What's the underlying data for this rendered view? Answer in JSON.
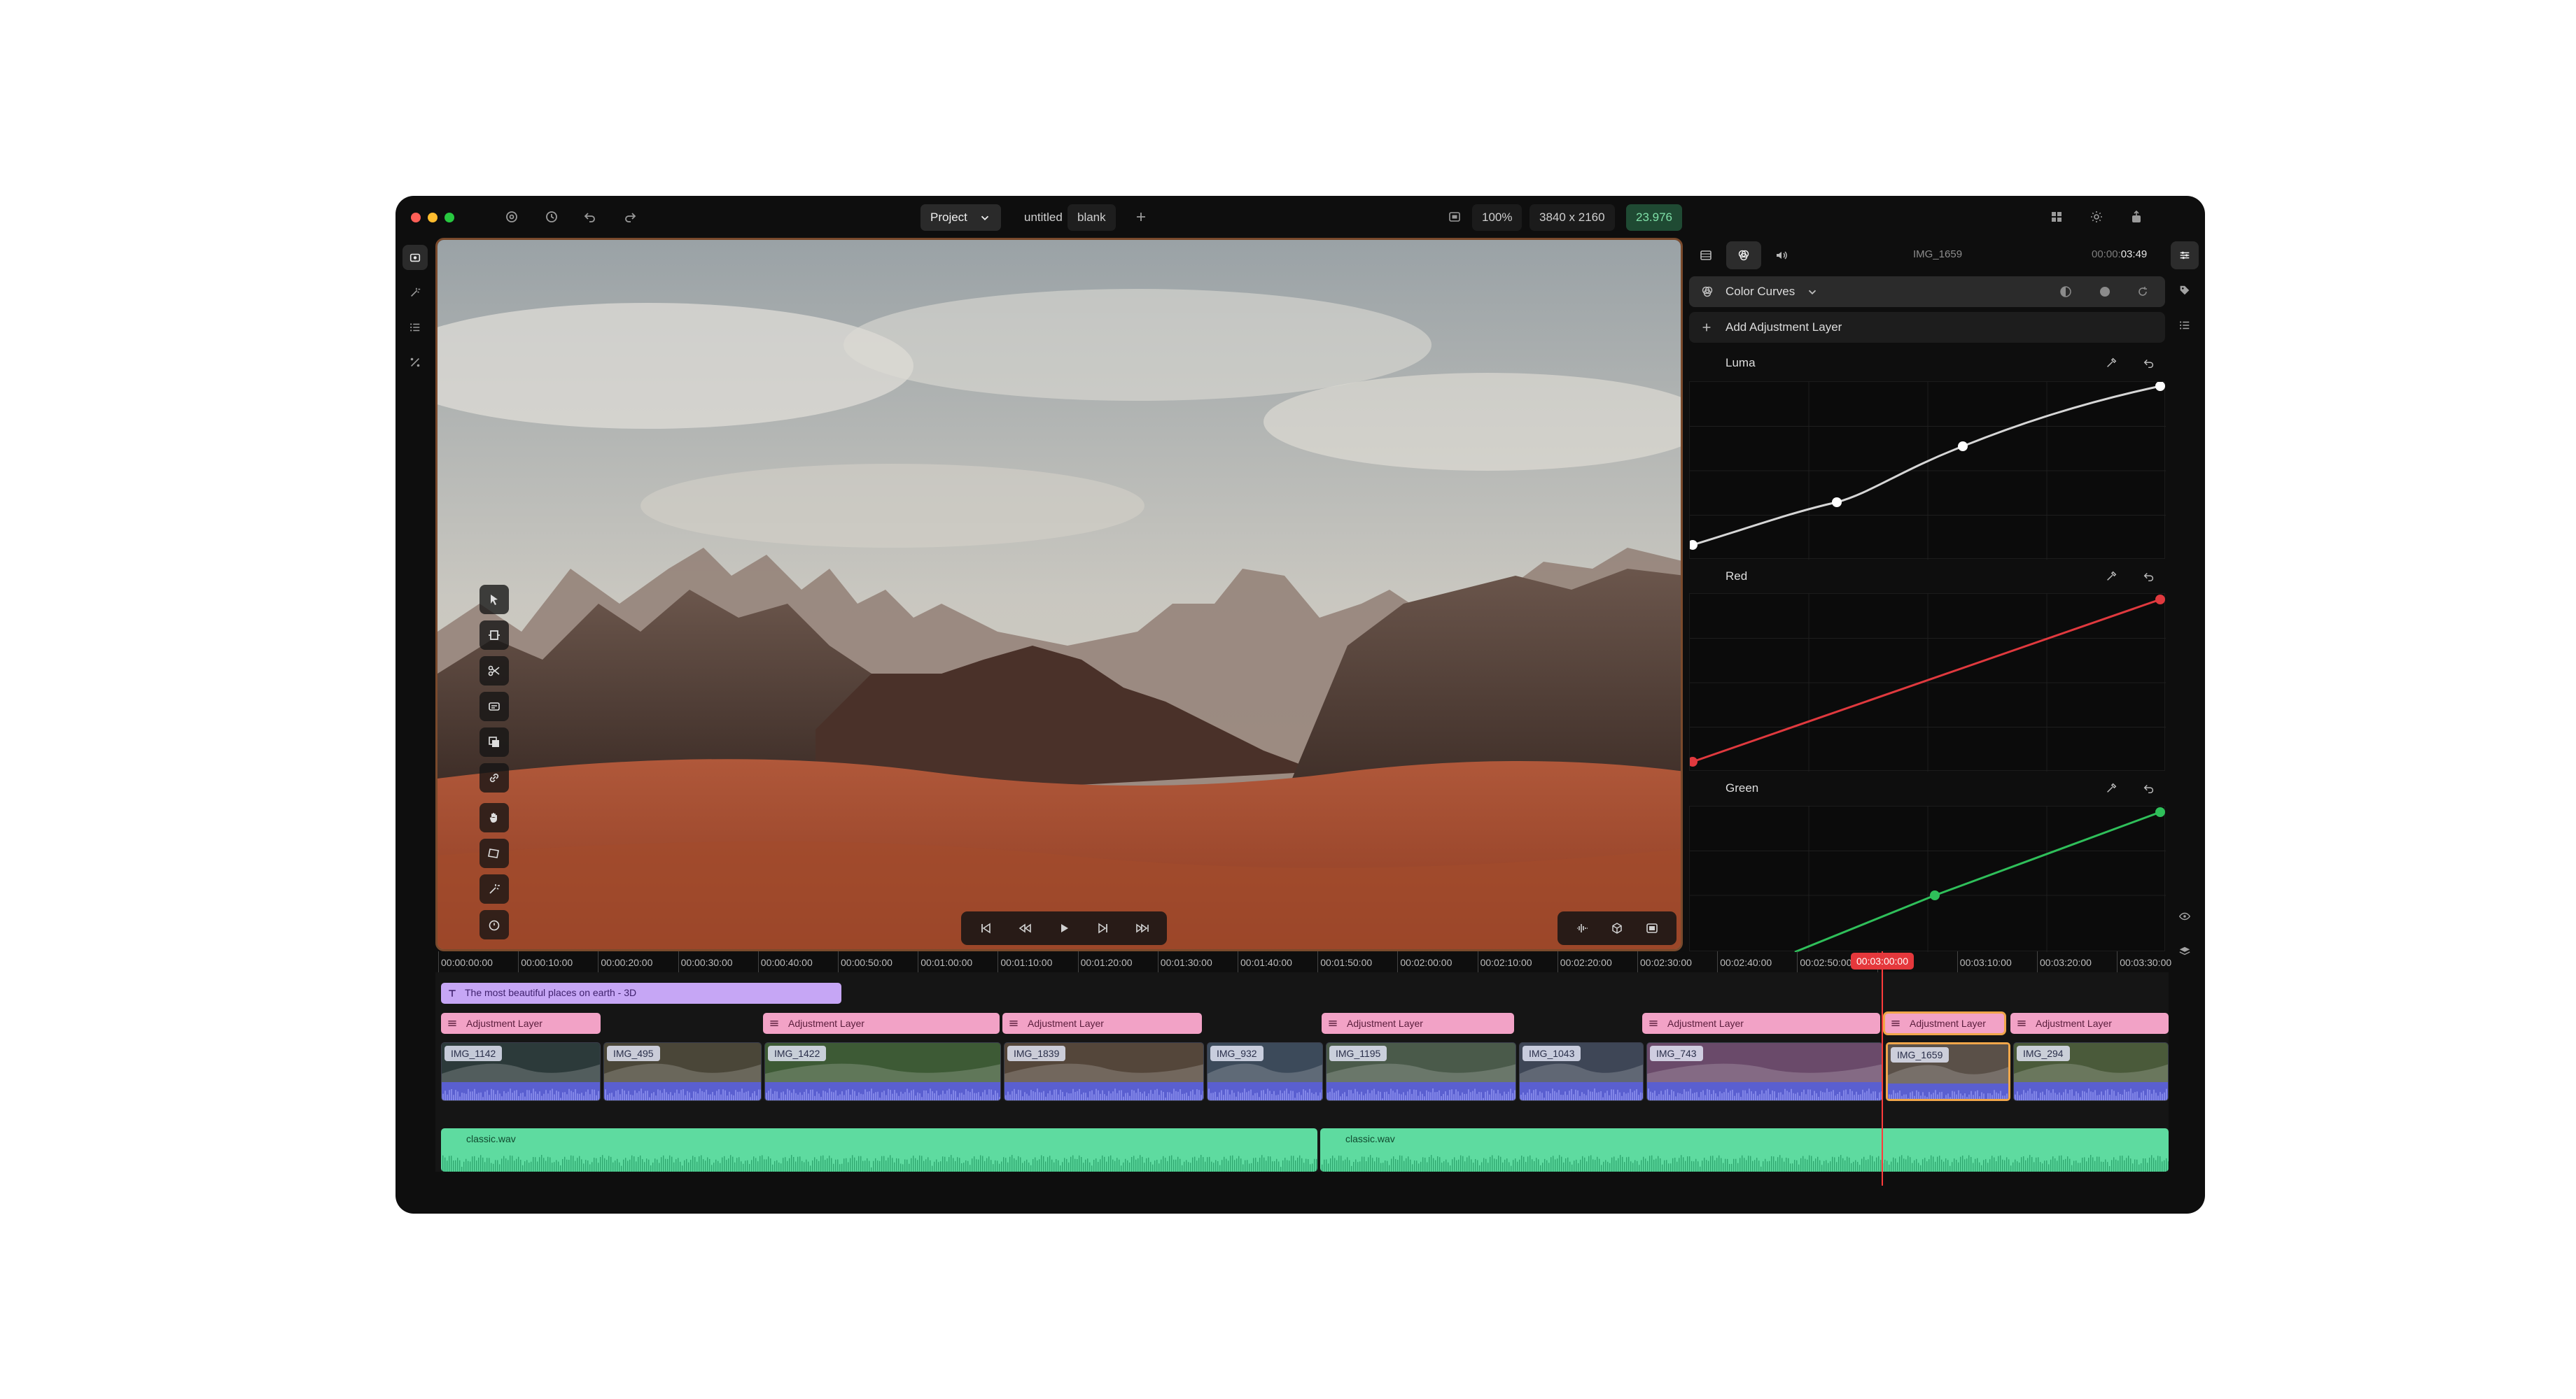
{
  "titlebar": {
    "project_label": "Project",
    "project_name": "untitled",
    "template_name": "blank",
    "zoom": "100%",
    "resolution": "3840 x 2160",
    "fps": "23.976"
  },
  "inspector": {
    "clip_name": "IMG_1659",
    "timecode_dim": "00:00:",
    "timecode_bright": "03:49",
    "effect_name": "Color Curves",
    "add_layer_label": "Add Adjustment Layer",
    "curves": [
      {
        "label": "Luma",
        "color": "#d6d6d6"
      },
      {
        "label": "Red",
        "color": "#e0393e"
      },
      {
        "label": "Green",
        "color": "#2fbf5a"
      }
    ]
  },
  "timeline": {
    "ruler_labels": [
      "00:00:00:00",
      "00:00:10:00",
      "00:00:20:00",
      "00:00:30:00",
      "00:00:40:00",
      "00:00:50:00",
      "00:01:00:00",
      "00:01:10:00",
      "00:01:20:00",
      "00:01:30:00",
      "00:01:40:00",
      "00:01:50:00",
      "00:02:00:00",
      "00:02:10:00",
      "00:02:20:00",
      "00:02:30:00",
      "00:02:40:00",
      "00:02:50:00",
      "00:03:00:00",
      "00:03:10:00",
      "00:03:20:00",
      "00:03:30:00"
    ],
    "playhead_label": "00:03:00:00",
    "text_clip": "The most beautiful places on earth - 3D",
    "adjustment_label": "Adjustment Layer",
    "video_clips": [
      "IMG_1142",
      "IMG_495",
      "IMG_1422",
      "IMG_1839",
      "IMG_932",
      "IMG_1195",
      "IMG_1043",
      "IMG_743",
      "IMG_1659",
      "IMG_294"
    ],
    "audio_clips": [
      "classic.wav",
      "classic.wav"
    ]
  },
  "colors": {
    "adjustment": "#f2a2c6",
    "text_clip": "#c6a6f5",
    "audio": "#5edba0",
    "playhead": "#e5383c",
    "fps_badge": "#1f4a33"
  }
}
